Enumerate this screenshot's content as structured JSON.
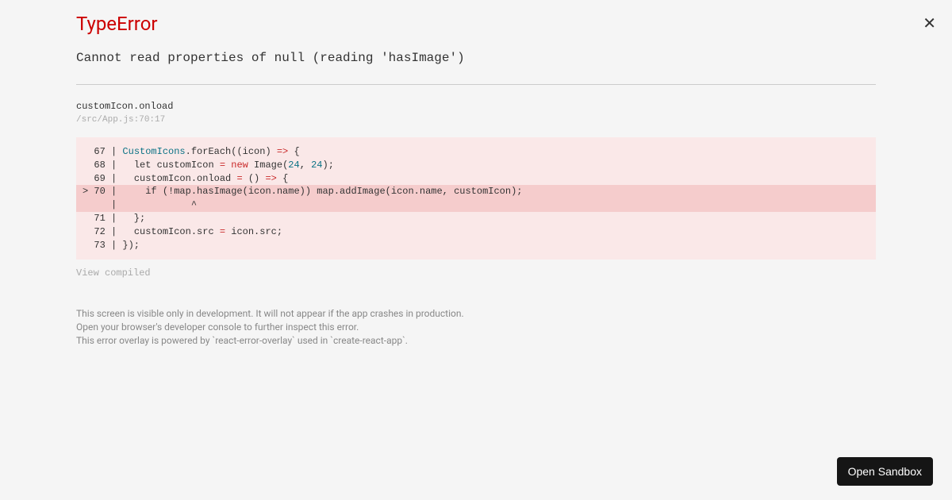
{
  "error": {
    "type": "TypeError",
    "message": "Cannot read properties of null (reading 'hasImage')",
    "function_name": "customIcon.onload",
    "file_location": "/src/App.js:70:17"
  },
  "code": {
    "line67_num": "  67 | ",
    "line67_class": "CustomIcons",
    "line67_rest1": ".forEach((icon) ",
    "line67_arrow": "=>",
    "line67_rest2": " {",
    "line68_num": "  68 | ",
    "line68_rest1": "  let customIcon ",
    "line68_eq": "=",
    "line68_sp": " ",
    "line68_new": "new",
    "line68_rest2": " Image(",
    "line68_n1": "24",
    "line68_comma": ", ",
    "line68_n2": "24",
    "line68_rest3": ");",
    "line69_num": "  69 | ",
    "line69_rest1": "  customIcon.onload ",
    "line69_eq": "=",
    "line69_rest2": " () ",
    "line69_arrow": "=>",
    "line69_rest3": " {",
    "line70": "> 70 |     if (!map.hasImage(icon.name)) map.addImage(icon.name, customIcon);",
    "line_caret": "     |             ^",
    "line71": "  71 |   };",
    "line72_num": "  72 | ",
    "line72_rest1": "  customIcon.src ",
    "line72_eq": "=",
    "line72_rest2": " icon.src;",
    "line73": "  73 | });"
  },
  "view_compiled": "View compiled",
  "footer": {
    "line1": "This screen is visible only in development. It will not appear if the app crashes in production.",
    "line2": "Open your browser's developer console to further inspect this error.",
    "line3": "This error overlay is powered by `react-error-overlay` used in `create-react-app`."
  },
  "sandbox_button": "Open Sandbox"
}
